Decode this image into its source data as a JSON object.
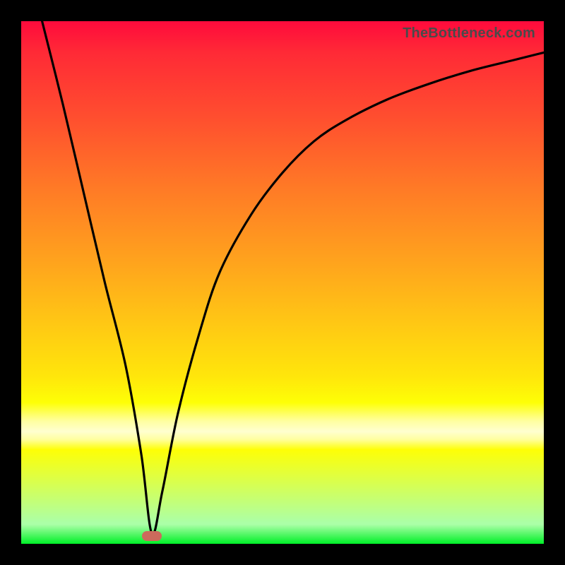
{
  "watermark": "TheBottleneck.com",
  "colors": {
    "background": "#000000",
    "gradient_top": "#ff0a3c",
    "gradient_mid1": "#ff7a26",
    "gradient_mid2": "#ffe60b",
    "gradient_band": "#ffffd0",
    "gradient_bottom": "#00f028",
    "curve": "#000000",
    "marker": "#cc6a5c"
  },
  "chart_data": {
    "type": "line",
    "title": "",
    "xlabel": "",
    "ylabel": "",
    "xlim": [
      0,
      100
    ],
    "ylim": [
      0,
      100
    ],
    "grid": false,
    "series": [
      {
        "name": "bottleneck-curve",
        "x": [
          4,
          8,
          12,
          16,
          20,
          23,
          25,
          27,
          30,
          34,
          38,
          44,
          50,
          56,
          62,
          70,
          78,
          86,
          94,
          100
        ],
        "y": [
          100,
          84,
          67,
          50,
          34,
          17,
          2,
          10,
          25,
          40,
          52,
          63,
          71,
          77,
          81,
          85,
          88,
          90.5,
          92.5,
          94
        ]
      }
    ],
    "marker": {
      "x": 25,
      "y": 1.5
    },
    "legend": false
  }
}
